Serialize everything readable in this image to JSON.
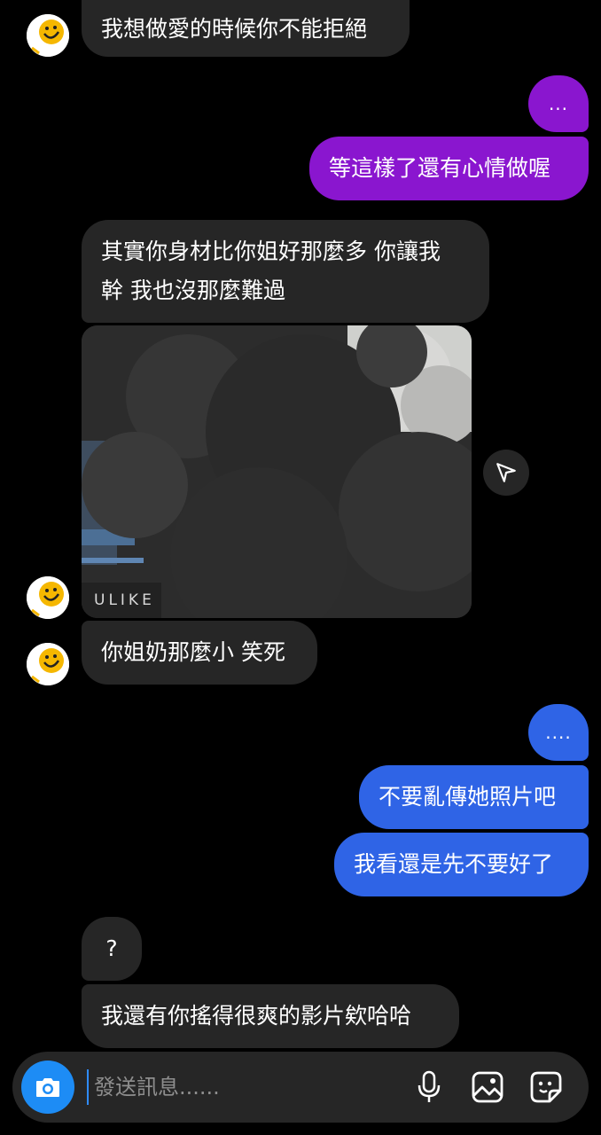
{
  "messages": {
    "m1": "我想做愛的時候你不能拒絕",
    "m2_dots": "...",
    "m3": "等這樣了還有心情做喔",
    "m4_line1": "其實你身材比你姐好那麼多 你讓我",
    "m4_line2": "幹 我也沒那麼難過",
    "media_label": "ULIKE",
    "m5": "你姐奶那麼小 笑死",
    "m6_dots": "....",
    "m7": "不要亂傳她照片吧",
    "m8": "我看還是先不要好了",
    "m9": "?",
    "m10": "我還有你搖得很爽的影片欸哈哈"
  },
  "composer": {
    "placeholder": "發送訊息......"
  },
  "colors": {
    "incoming_bubble": "#262626",
    "outgoing_purple": "#8a16cf",
    "outgoing_blue": "#2f64e6",
    "camera_button": "#1d8cf5"
  },
  "icons": {
    "avatar": "smiley-emoji-icon",
    "share": "send-arrow-icon",
    "camera": "camera-icon",
    "mic": "microphone-icon",
    "gallery": "image-icon",
    "sticker": "sticker-icon"
  }
}
